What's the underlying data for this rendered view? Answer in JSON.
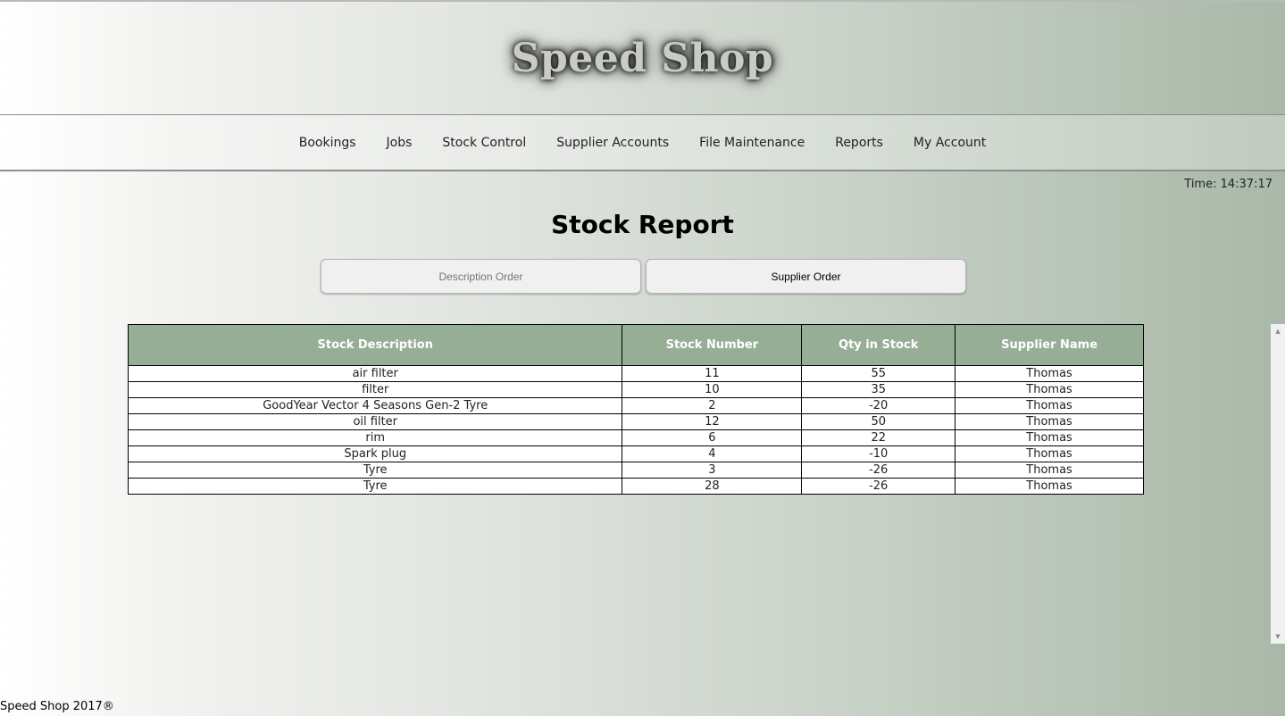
{
  "header": {
    "title": "Speed Shop"
  },
  "nav": {
    "items": [
      "Bookings",
      "Jobs",
      "Stock Control",
      "Supplier Accounts",
      "File Maintenance",
      "Reports",
      "My Account"
    ]
  },
  "clock": {
    "text": "Time: 14:37:17"
  },
  "page": {
    "title": "Stock Report"
  },
  "buttons": {
    "description_order": "Description Order",
    "supplier_order": "Supplier Order"
  },
  "table": {
    "headers": [
      "Stock Description",
      "Stock Number",
      "Qty in Stock",
      "Supplier Name"
    ],
    "rows": [
      [
        "air filter",
        "11",
        "55",
        "Thomas"
      ],
      [
        "filter",
        "10",
        "35",
        "Thomas"
      ],
      [
        "GoodYear Vector 4 Seasons Gen-2 Tyre",
        "2",
        "-20",
        "Thomas"
      ],
      [
        "oil filter",
        "12",
        "50",
        "Thomas"
      ],
      [
        "rim",
        "6",
        "22",
        "Thomas"
      ],
      [
        "Spark plug",
        "4",
        "-10",
        "Thomas"
      ],
      [
        "Tyre",
        "3",
        "-26",
        "Thomas"
      ],
      [
        "Tyre",
        "28",
        "-26",
        "Thomas"
      ]
    ]
  },
  "scrollbar": {
    "up_icon": "▲",
    "down_icon": "▼"
  },
  "footer": {
    "text": "Speed Shop 2017®"
  },
  "colors": {
    "table_header": "#96ae96",
    "background_end": "#a9b8a8"
  }
}
